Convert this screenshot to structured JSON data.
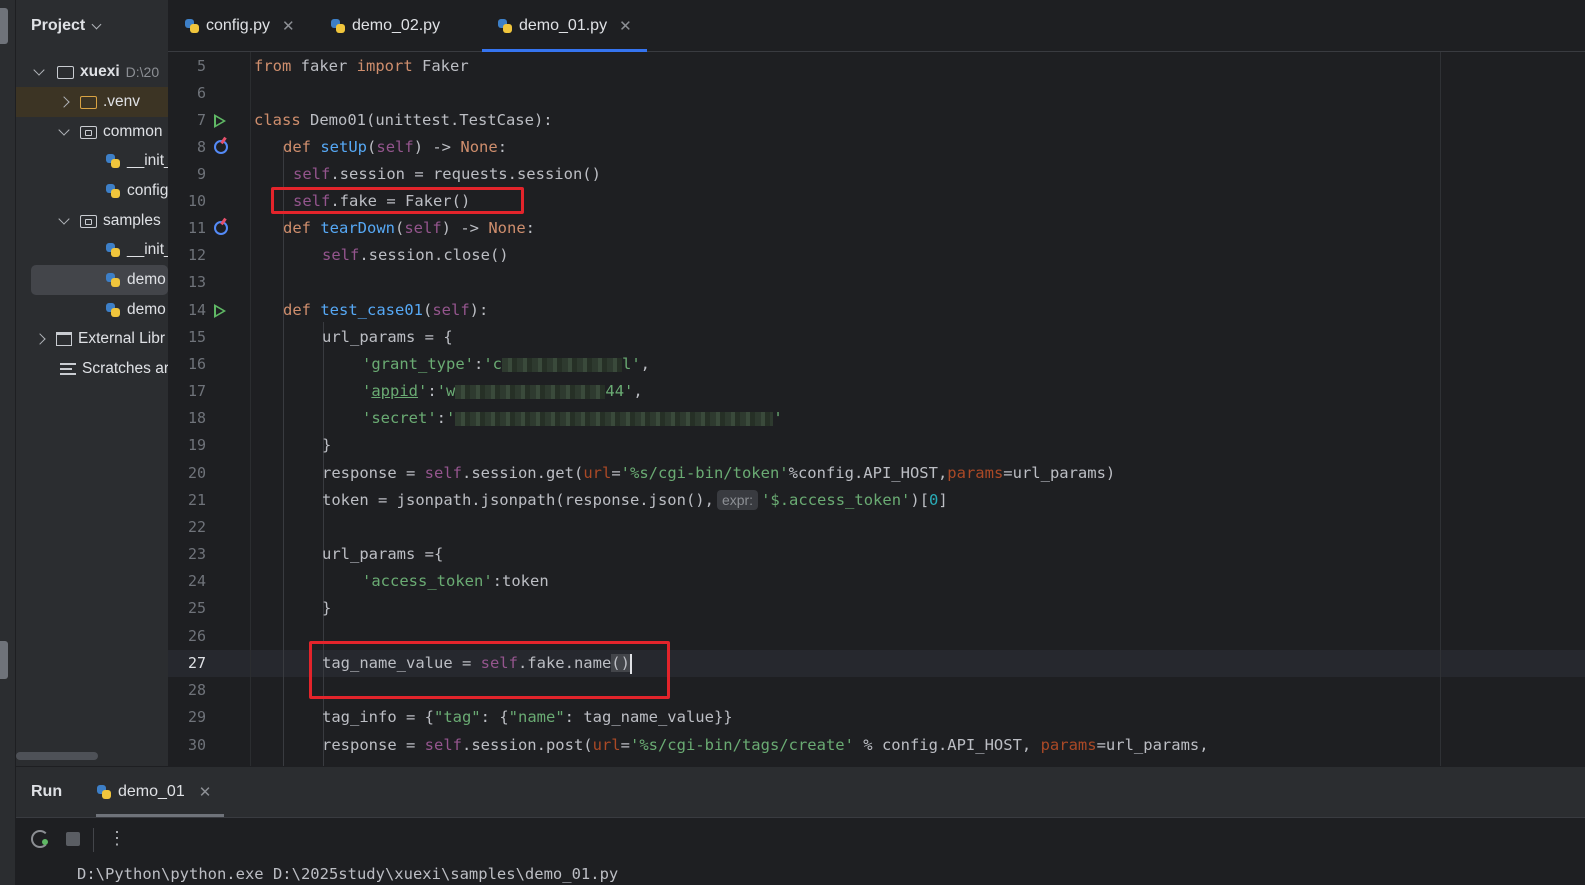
{
  "project_panel": {
    "title": "Project",
    "tree": [
      {
        "label": "xuexi",
        "path_hint": "D:\\20"
      },
      {
        "label": ".venv"
      },
      {
        "label": "common"
      },
      {
        "label": "__init_"
      },
      {
        "label": "config"
      },
      {
        "label": "samples"
      },
      {
        "label": "__init_"
      },
      {
        "label": "demo"
      },
      {
        "label": "demo"
      },
      {
        "label": "External Libr"
      },
      {
        "label": "Scratches ar"
      }
    ]
  },
  "editor_tabs": [
    {
      "label": "config.py",
      "active": false
    },
    {
      "label": "demo_02.py",
      "active": false
    },
    {
      "label": "demo_01.py",
      "active": true
    }
  ],
  "code": {
    "current_line": "27",
    "lines": [
      {
        "n": "5",
        "text": "from faker import Faker"
      },
      {
        "n": "6",
        "text": ""
      },
      {
        "n": "7",
        "text": "class Demo01(unittest.TestCase):"
      },
      {
        "n": "8",
        "text": "def setUp(self) -> None:"
      },
      {
        "n": "9",
        "text": "self.session = requests.session()"
      },
      {
        "n": "10",
        "text": "self.fake = Faker()"
      },
      {
        "n": "11",
        "text": "def tearDown(self) -> None:"
      },
      {
        "n": "12",
        "text": "self.session.close()"
      },
      {
        "n": "13",
        "text": ""
      },
      {
        "n": "14",
        "text": "def test_case01(self):"
      },
      {
        "n": "15",
        "text": "url_params = {"
      },
      {
        "n": "16",
        "text": "'grant_type':'c…l',"
      },
      {
        "n": "17",
        "text": "'appid':'w…44',"
      },
      {
        "n": "18",
        "text": "'secret':'…'"
      },
      {
        "n": "19",
        "text": "}"
      },
      {
        "n": "20",
        "text": "response = self.session.get(url='%s/cgi-bin/token'%config.API_HOST,params=url_params)"
      },
      {
        "n": "21",
        "text": "token = jsonpath.jsonpath(response.json(), expr: '$.access_token')[0]"
      },
      {
        "n": "22",
        "text": ""
      },
      {
        "n": "23",
        "text": "url_params ={"
      },
      {
        "n": "24",
        "text": "'access_token':token"
      },
      {
        "n": "25",
        "text": "}"
      },
      {
        "n": "26",
        "text": ""
      },
      {
        "n": "27",
        "text": "tag_name_value = self.fake.name()"
      },
      {
        "n": "28",
        "text": ""
      },
      {
        "n": "29",
        "text": "tag_info = {\"tag\": {\"name\": tag_name_value}}"
      },
      {
        "n": "30",
        "text": "response = self.session.post(url='%s/cgi-bin/tags/create' % config.API_HOST, params=url_params,"
      }
    ]
  },
  "run_panel": {
    "title": "Run",
    "tab_label": "demo_01",
    "console_line": "D:\\Python\\python.exe D:\\2025study\\xuexi\\samples\\demo_01.py"
  },
  "colors": {
    "keyword": "#cf8e6d",
    "function": "#56a8f5",
    "self": "#94558d",
    "string": "#6aab73",
    "number": "#2aacb8",
    "param": "#aa4926",
    "highlight_box": "#e3242b",
    "tab_underline": "#3574f0"
  }
}
